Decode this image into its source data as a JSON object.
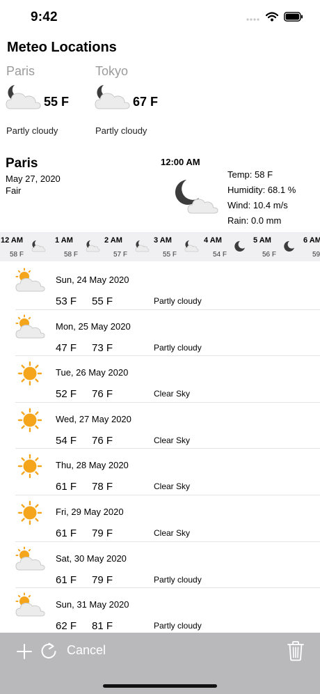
{
  "status_bar": {
    "time": "9:42"
  },
  "app_title": "Meteo Locations",
  "locations": [
    {
      "name": "Paris",
      "temp": "55 F",
      "condition": "Partly cloudy",
      "icon": "moon-cloud-icon"
    },
    {
      "name": "Tokyo",
      "temp": "67 F",
      "condition": "Partly cloudy",
      "icon": "moon-cloud-icon"
    }
  ],
  "current": {
    "city": "Paris",
    "date": "May 27, 2020",
    "condition": "Fair",
    "time": "12:00 AM",
    "temp": "Temp: 58 F",
    "humidity": "Humidity: 68.1 %",
    "wind": "Wind: 10.4 m/s",
    "rain": "Rain: 0.0 mm",
    "icon": "moon-cloud-icon"
  },
  "hourly": [
    {
      "time": "12 AM",
      "temp": "58 F",
      "icon": "moon-cloud-icon"
    },
    {
      "time": "1 AM",
      "temp": "58 F",
      "icon": "moon-cloud-icon"
    },
    {
      "time": "2 AM",
      "temp": "57 F",
      "icon": "moon-cloud-icon"
    },
    {
      "time": "3 AM",
      "temp": "55 F",
      "icon": "moon-cloud-icon"
    },
    {
      "time": "4 AM",
      "temp": "54 F",
      "icon": "moon-icon"
    },
    {
      "time": "5 AM",
      "temp": "56 F",
      "icon": "moon-icon"
    },
    {
      "time": "6 AM",
      "temp": "59",
      "icon": "moon-icon"
    }
  ],
  "daily": [
    {
      "date": "Sun, 24 May 2020",
      "low": "53 F",
      "high": "55 F",
      "condition": "Partly cloudy",
      "icon": "sun-cloud-icon"
    },
    {
      "date": "Mon, 25 May 2020",
      "low": "47 F",
      "high": "73 F",
      "condition": "Partly cloudy",
      "icon": "sun-cloud-icon"
    },
    {
      "date": "Tue, 26 May 2020",
      "low": "52 F",
      "high": "76 F",
      "condition": "Clear Sky",
      "icon": "sun-icon"
    },
    {
      "date": "Wed, 27 May 2020",
      "low": "54 F",
      "high": "76 F",
      "condition": "Clear Sky",
      "icon": "sun-icon"
    },
    {
      "date": "Thu, 28 May 2020",
      "low": "61 F",
      "high": "78 F",
      "condition": "Clear Sky",
      "icon": "sun-icon"
    },
    {
      "date": "Fri, 29 May 2020",
      "low": "61 F",
      "high": "79 F",
      "condition": "Clear Sky",
      "icon": "sun-icon"
    },
    {
      "date": "Sat, 30 May 2020",
      "low": "61 F",
      "high": "79 F",
      "condition": "Partly cloudy",
      "icon": "sun-cloud-icon"
    },
    {
      "date": "Sun, 31 May 2020",
      "low": "62 F",
      "high": "81 F",
      "condition": "Partly cloudy",
      "icon": "sun-cloud-icon"
    }
  ],
  "toolbar": {
    "cancel_label": "Cancel"
  },
  "colors": {
    "toolbar_bg": "#b9b9bc",
    "hourly_bg": "#f0f0f2",
    "sun": "#f4a51c",
    "moon": "#3c3c3c"
  }
}
